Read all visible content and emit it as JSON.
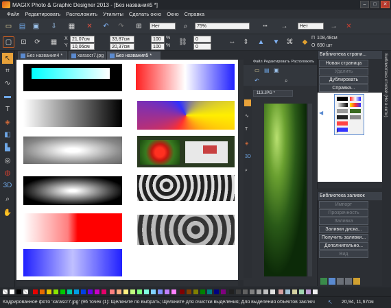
{
  "window": {
    "title": "MAGIX Photo & Graphic Designer 2013 - [Без названия5 *]"
  },
  "menu": [
    "Файл",
    "Редактировать",
    "Расположить",
    "Утилиты",
    "Сделать окно",
    "Окно",
    "Справка"
  ],
  "toolbar1": {
    "dropdown1": "Нет",
    "zoom": "75%",
    "dropdown2": "Нет"
  },
  "toolbar2": {
    "x_label": "X",
    "x_value": "21,07см",
    "y_label": "Y",
    "y_value": "10,06см",
    "w_value": "33,87см",
    "h_value": "20,37см",
    "w_pct": "100",
    "w_pct_unit": "%",
    "h_pct": "100",
    "h_pct_unit": "%",
    "rot": "0",
    "skew": "0",
    "p_label": "П",
    "p_value": "108,48см",
    "o_label": "О",
    "o_value": "690 шт"
  },
  "doctabs": [
    "Без названия4 *",
    "xarascr7.jpg",
    "Без названия5 *"
  ],
  "panel2": {
    "menu": [
      "Файл",
      "Редактировать",
      "Расположить"
    ],
    "tab": "113.JPG *"
  },
  "layers": {
    "title": "Библиотека страни...",
    "buttons": [
      "Новая страница",
      "Удалить",
      "Дублировать",
      "Справка..."
    ],
    "page_number": "1"
  },
  "fills": {
    "title": "Библиотека заливок",
    "buttons": [
      "Импорт",
      "Прозрачность",
      "Заливка",
      "Заливки диска...",
      "Получить заливки...",
      "Дополнительно...",
      "Вид"
    ]
  },
  "vtab": "Библиотека стилей (Не в сети)",
  "status": {
    "text": "Кадрированное фото 'xarascr7.jpg' (96 точек  (1): Щелкните по выбрать; Щелкните для очистки выделения; Для выделения объектов заключ",
    "coords": "20,94, 11,67см"
  },
  "colors": {
    "accent": "#4a7fc1",
    "bg": "#2a2d32"
  }
}
